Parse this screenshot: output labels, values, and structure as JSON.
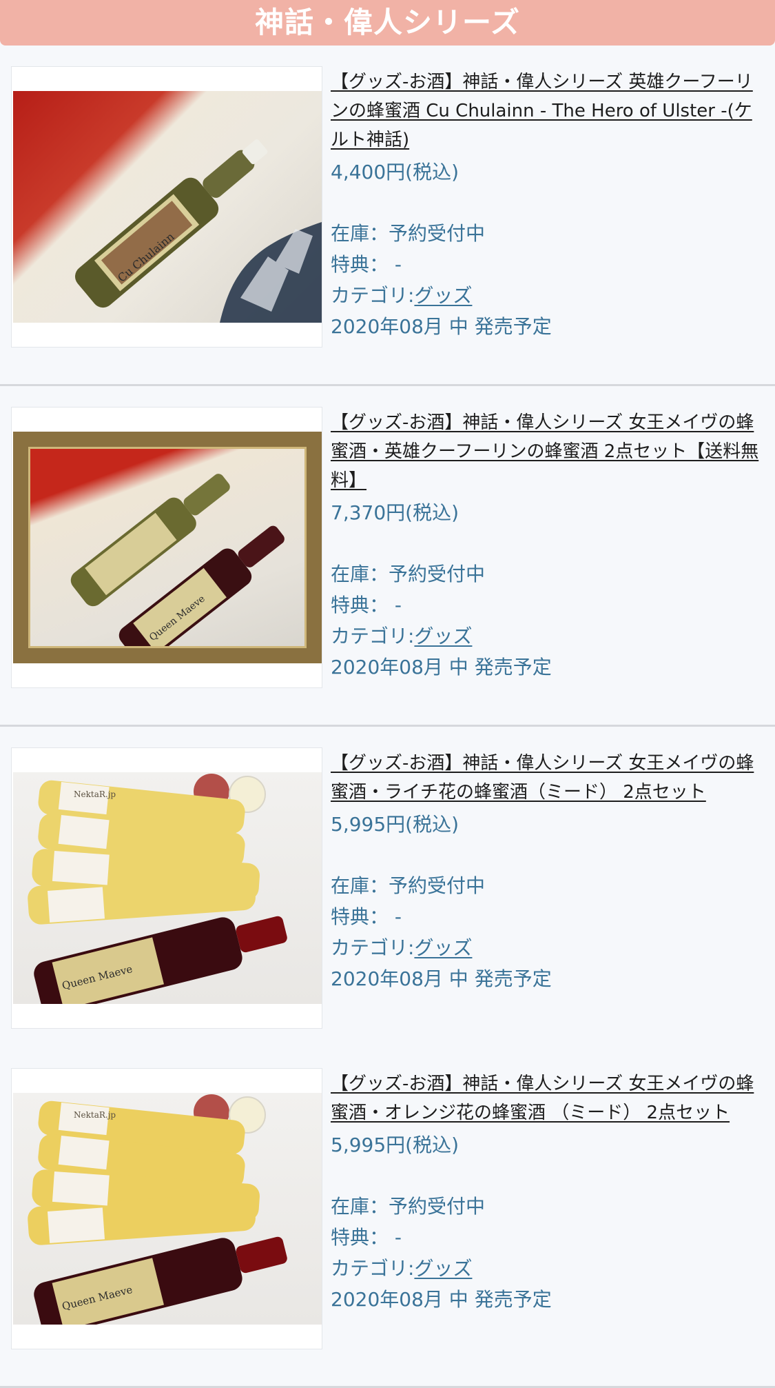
{
  "header": {
    "title": "神話・偉人シリーズ"
  },
  "products": [
    {
      "title": "【グッズ-お酒】神話・偉人シリーズ 英雄クーフーリンの蜂蜜酒 Cu Chulainn - The Hero of Ulster -(ケルト神話)",
      "price": "4,400円(税込)",
      "stock": "在庫：予約受付中",
      "bonus": "特典： -",
      "category_prefix": "カテゴリ:",
      "category_link": "グッズ",
      "release": "2020年08月 中 発売予定"
    },
    {
      "title": "【グッズ-お酒】神話・偉人シリーズ 女王メイヴの蜂蜜酒・英雄クーフーリンの蜂蜜酒 2点セット【送料無料】",
      "price": "7,370円(税込)",
      "stock": "在庫：予約受付中",
      "bonus": "特典： -",
      "category_prefix": "カテゴリ:",
      "category_link": "グッズ",
      "release": "2020年08月 中 発売予定"
    },
    {
      "title": "【グッズ-お酒】神話・偉人シリーズ 女王メイヴの蜂蜜酒・ライチ花の蜂蜜酒（ミード） 2点セット",
      "price": "5,995円(税込)",
      "stock": "在庫：予約受付中",
      "bonus": "特典： -",
      "category_prefix": "カテゴリ:",
      "category_link": "グッズ",
      "release": "2020年08月 中 発売予定"
    },
    {
      "title": "【グッズ-お酒】神話・偉人シリーズ 女王メイヴの蜂蜜酒・オレンジ花の蜂蜜酒 （ミード） 2点セット",
      "price": "5,995円(税込)",
      "stock": "在庫：予約受付中",
      "bonus": "特典： -",
      "category_prefix": "カテゴリ:",
      "category_link": "グッズ",
      "release": "2020年08月 中 発売予定"
    }
  ],
  "labels": {
    "bottle_a": "Cu Chulainn",
    "bottle_b": "Queen Maeve",
    "bottle_c": "NektaR.jp"
  }
}
